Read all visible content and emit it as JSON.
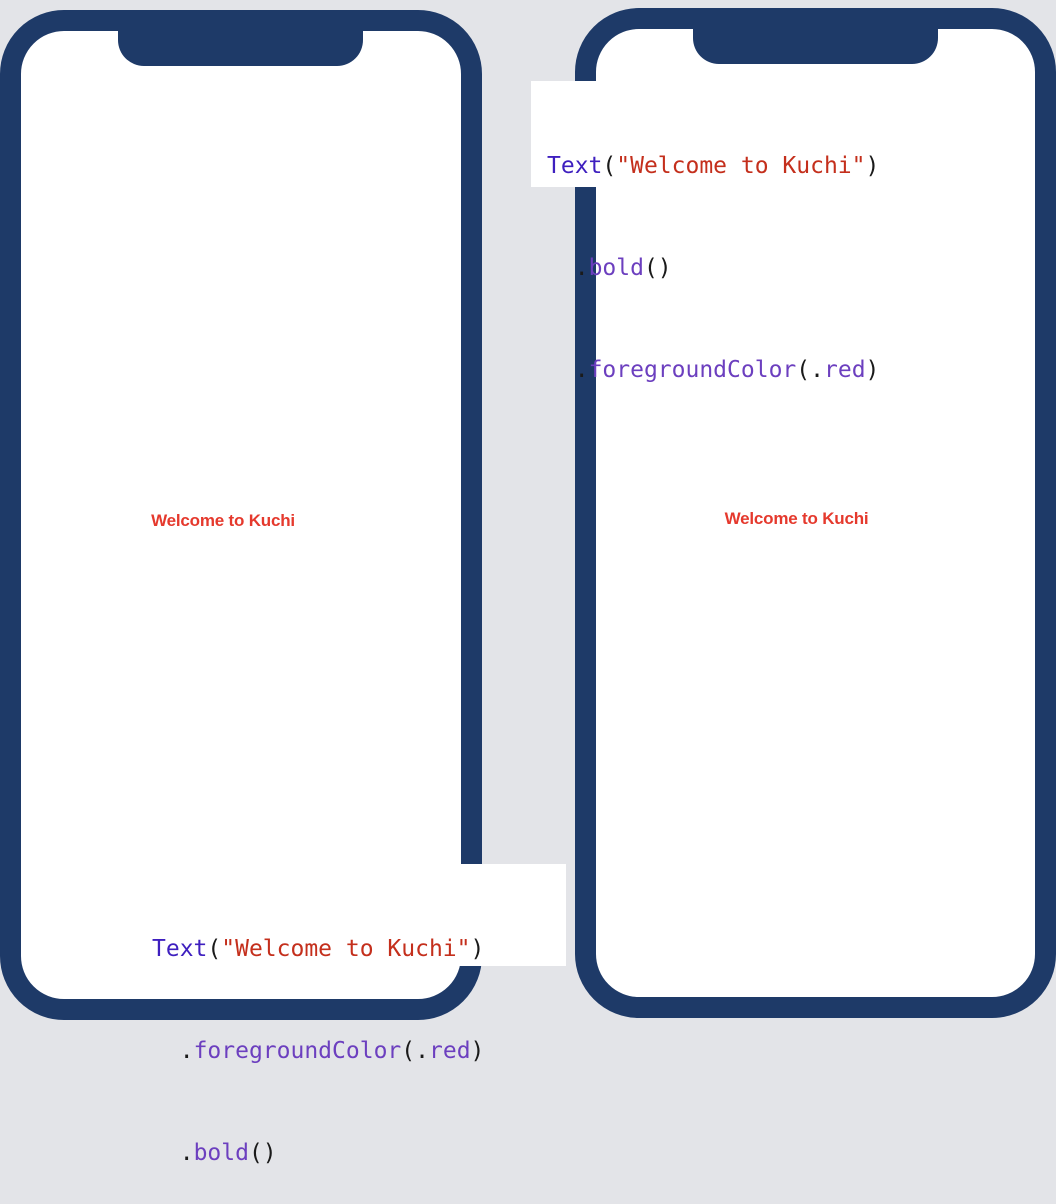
{
  "left_example": {
    "preview_text": "Welcome to Kuchi",
    "code": {
      "line1": {
        "type": "Text",
        "open": "(",
        "string": "\"Welcome to Kuchi\"",
        "close": ")"
      },
      "line2": {
        "dot": ".",
        "method": "foregroundColor",
        "open": "(",
        "arg_dot": ".",
        "arg": "red",
        "close": ")"
      },
      "line3": {
        "dot": ".",
        "method": "bold",
        "parens": "()"
      }
    }
  },
  "right_example": {
    "preview_text": "Welcome to Kuchi",
    "code": {
      "line1": {
        "type": "Text",
        "open": "(",
        "string": "\"Welcome to Kuchi\"",
        "close": ")"
      },
      "line2": {
        "dot": ".",
        "method": "bold",
        "parens": "()"
      },
      "line3": {
        "dot": ".",
        "method": "foregroundColor",
        "open": "(",
        "arg_dot": ".",
        "arg": "red",
        "close": ")"
      }
    }
  },
  "colors": {
    "phone_frame": "#1e3a68",
    "background": "#e3e4e8",
    "preview_text": "#e5392d",
    "code_type": "#3e1fbf",
    "code_string": "#c42f1c",
    "code_method": "#6c3fbf"
  }
}
